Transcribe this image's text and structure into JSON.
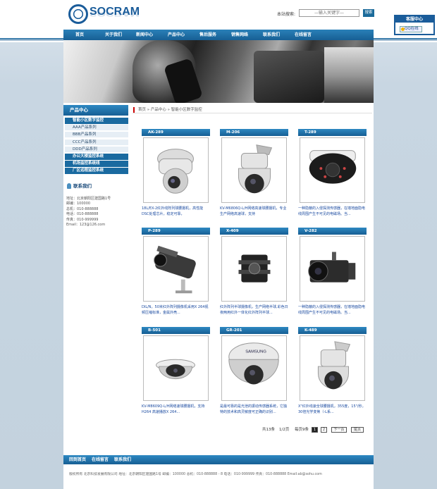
{
  "header": {
    "logo_text": "SOCRAM",
    "search_label": "本站搜索:",
    "search_placeholder": "—输入关键字—",
    "search_button": "搜索"
  },
  "service": {
    "title": "客服中心",
    "qq_label": "QQ在线"
  },
  "nav": {
    "items": [
      "首页",
      "关于我们",
      "新闻中心",
      "产品中心",
      "售后服务",
      "销售网络",
      "联系我们",
      "在线留言"
    ]
  },
  "sidebar": {
    "title": "产品中心",
    "categories": [
      {
        "label": "智能小区数字监控",
        "type": "main"
      },
      {
        "label": "AAA产品系列",
        "type": "sub"
      },
      {
        "label": "BBB产品系列",
        "type": "sub"
      },
      {
        "label": "CCC产品系列",
        "type": "sub"
      },
      {
        "label": "DDD产品系列",
        "type": "sub"
      },
      {
        "label": "办公大楼监控系统",
        "type": "main"
      },
      {
        "label": "机场监控系统线",
        "type": "main"
      },
      {
        "label": "厂区远程监控系统",
        "type": "main"
      }
    ],
    "contact_title": "联系我们",
    "contact_lines": [
      "地址：北京朝阳区建国路1号",
      "邮编：100000",
      "总机：010-888888",
      "电话：010-888888",
      "传真：010-999999",
      "Email：123@126.com"
    ]
  },
  "breadcrumb": "首页 » 产品中心 » 智能小区数字监控",
  "products": [
    {
      "code": "AK-289",
      "desc": "18L/EX-2红外线阵列球腰摄机，高性能DSC处理芯片，稳定可靠，",
      "icon": "ptz-dome-camera"
    },
    {
      "code": "M-206",
      "desc": "KV-M6806Q-L/H网络高速球腰摄机，专业生产网络高速球，支持",
      "icon": "speed-dome-camera"
    },
    {
      "code": "T-289",
      "desc": "一种隐蔽的入侵探测传感器，在墙地面隐电线周围产生不可见的电磁场。当...",
      "icon": "ir-dome-camera"
    },
    {
      "code": "P-289",
      "desc": "DIL/N，50米红外阵列摄像机采用X 264视频压缩标准，金属外壳...",
      "icon": "bullet-camera"
    },
    {
      "code": "X-409",
      "desc": "红外阵列半球摄像机，生产网络半球,彩色日夜两用红外一体化红外阵列半球...",
      "icon": "camera-lens"
    },
    {
      "code": "V-282",
      "desc": "一种隐蔽的入侵探测传感器，在墙地面隐电线周围产生不可见的电磁场。当...",
      "icon": "box-camera"
    },
    {
      "code": "B-501",
      "desc": "KV-M8609Q-L/H网络速球腰摄机，支持H264 高速播放X 264...",
      "icon": "mini-dome-camera"
    },
    {
      "code": "GR-201",
      "desc": "是最可靠的是光泄的振动传感器系统，它独特的技术和高灵敏度可正确的识别...",
      "icon": "vandal-dome-camera"
    },
    {
      "code": "K-489",
      "desc": "X\"红外线速全球腰摄机，355度，15\"/秒，30倍光学变焦（-L系...",
      "icon": "outdoor-speed-dome"
    }
  ],
  "pager": {
    "total": "共13条",
    "pages": "1/2页",
    "per_page": "每页9条",
    "page1": "1",
    "page2": "2",
    "next": "下一页",
    "last": "尾页"
  },
  "footer": {
    "links": [
      "回到首页",
      "在线留言",
      "联系我们"
    ],
    "copyright": "版权所有  北京科技发展有限公司  地址：北京朝阳区建国路1号  邮编：100000    总机：010-888888 - 8 电话：010-999999  传真：010-888888  Email:ab@sohu.com"
  },
  "colors": {
    "brand": "#1a5c9a",
    "nav": "#175f94",
    "link": "#1a4aa0"
  }
}
